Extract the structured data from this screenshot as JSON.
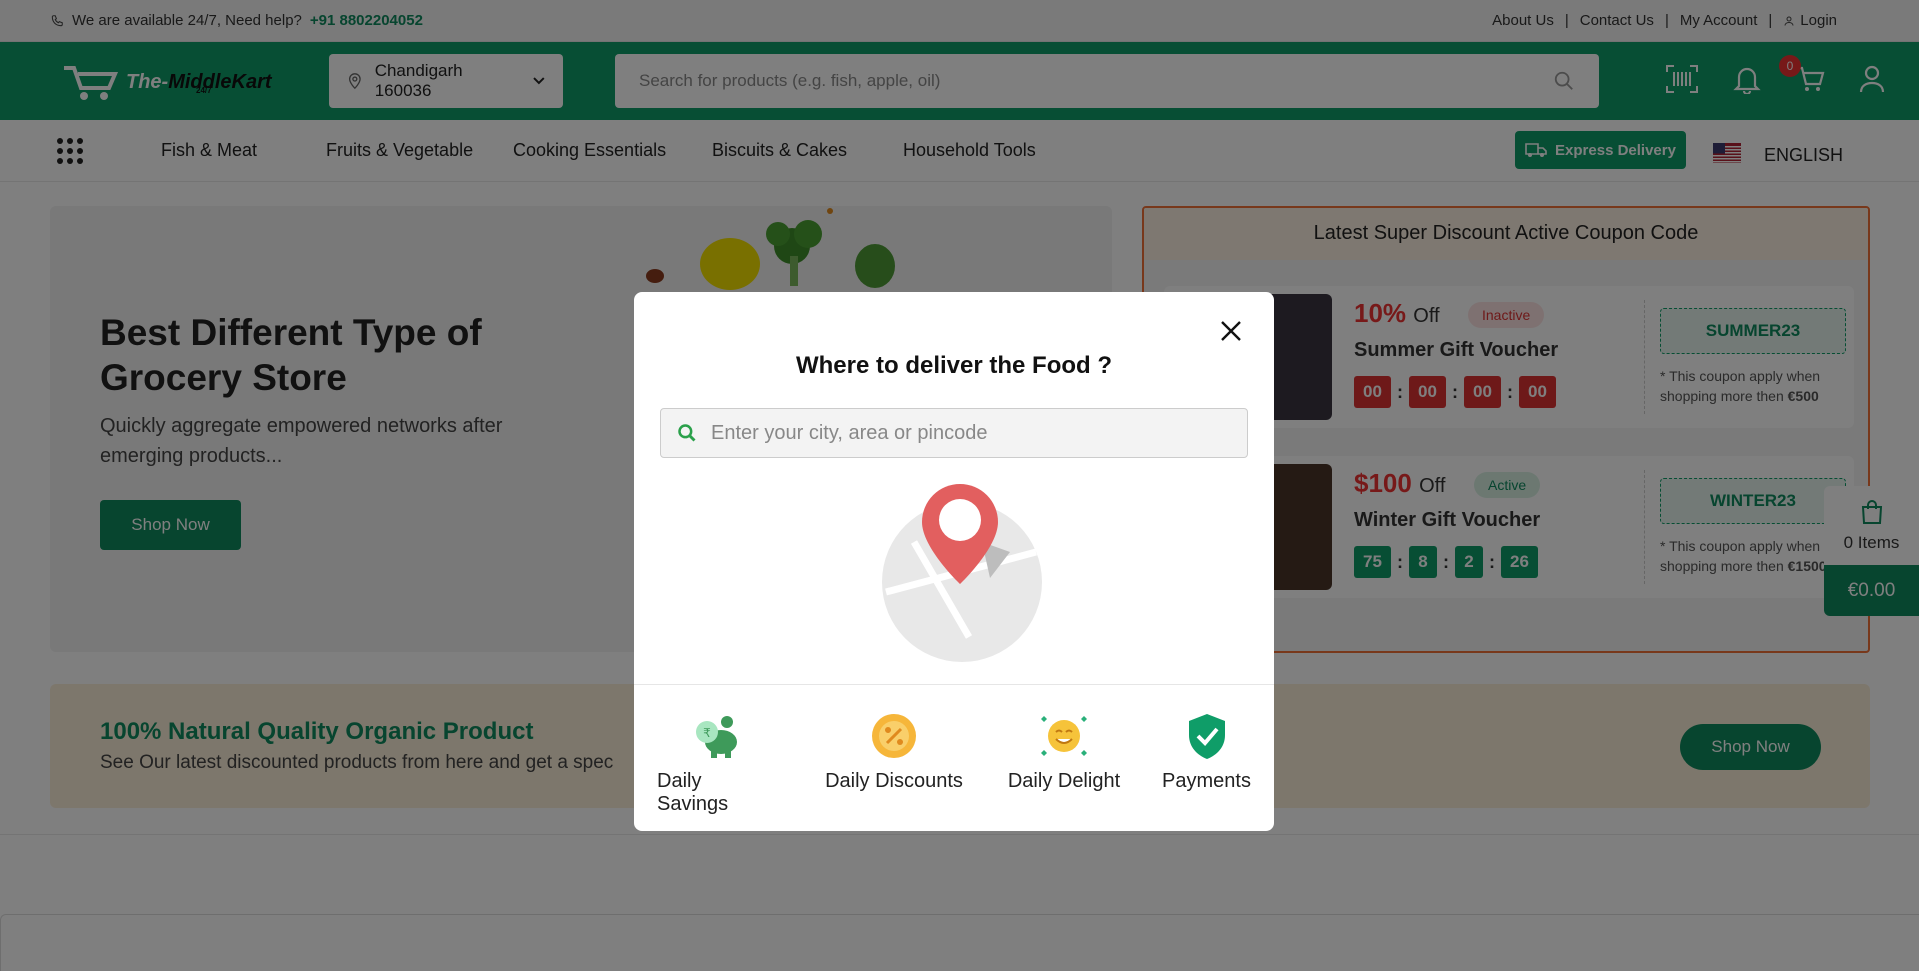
{
  "topbar": {
    "help_text": "We are available 24/7, Need help?",
    "phone": "+91 8802204052",
    "links": [
      "About Us",
      "Contact Us",
      "My Account",
      "Login"
    ]
  },
  "header": {
    "logo_text_a": "The-",
    "logo_text_b": "MiddleKart",
    "logo_sub": "24/7",
    "location": "Chandigarh 160036",
    "search_placeholder": "Search for products (e.g. fish, apple, oil)",
    "cart_count": "0"
  },
  "nav": {
    "items": [
      "Fish & Meat",
      "Fruits & Vegetable",
      "Cooking Essentials",
      "Biscuits & Cakes",
      "Household Tools"
    ],
    "express": "Express Delivery",
    "language": "ENGLISH"
  },
  "hero": {
    "title": "Best Different Type of Grocery Store",
    "subtitle": "Quickly aggregate empowered networks after emerging products...",
    "button": "Shop Now"
  },
  "coupons": {
    "header": "Latest Super Discount Active Coupon Code",
    "items": [
      {
        "discount": "10%",
        "off": "Off",
        "status": "Inactive",
        "title": "Summer Gift Voucher",
        "timer": [
          "00",
          "00",
          "00",
          "00"
        ],
        "code": "SUMMER23",
        "note_prefix": "* This coupon apply when shopping more then ",
        "note_amount": "€500"
      },
      {
        "discount": "$100",
        "off": "Off",
        "status": "Active",
        "title": "Winter Gift Voucher",
        "timer": [
          "75",
          "8",
          "2",
          "26"
        ],
        "code": "WINTER23",
        "note_prefix": "* This coupon apply when shopping more then ",
        "note_amount": "€1500"
      }
    ]
  },
  "banner": {
    "title": "100% Natural Quality Organic Product",
    "text": "See Our latest discounted products from here and get a spec",
    "button": "Shop Now"
  },
  "sidecart": {
    "items": "0 Items",
    "price": "€0.00"
  },
  "modal": {
    "title": "Where to deliver the Food ?",
    "placeholder": "Enter your city, area or pincode",
    "features": [
      "Daily Savings",
      "Daily Discounts",
      "Daily Delight",
      "Payments"
    ]
  },
  "colors": {
    "brand": "#0f9d68",
    "brand_dark": "#0f8a5f",
    "danger": "#e33333",
    "coupon_border": "#f07036"
  }
}
